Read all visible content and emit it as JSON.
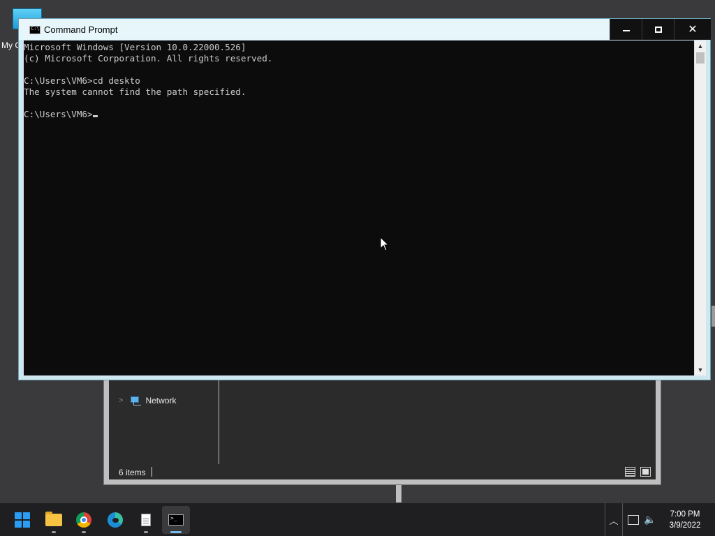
{
  "desktop": {
    "icon_label": "My C"
  },
  "explorer": {
    "nav_items": [
      {
        "label": "Network",
        "icon": "network-icon"
      }
    ],
    "status_text": "6 items"
  },
  "cmd": {
    "title": "Command Prompt",
    "lines": [
      "Microsoft Windows [Version 10.0.22000.526]",
      "(c) Microsoft Corporation. All rights reserved.",
      "",
      "C:\\Users\\VM6>cd deskto",
      "The system cannot find the path specified.",
      "",
      "C:\\Users\\VM6>"
    ],
    "controls": {
      "minimize": "minimize-icon",
      "maximize": "maximize-icon",
      "close": "close-icon"
    }
  },
  "taskbar": {
    "apps": [
      {
        "name": "start",
        "icon": "windows-start-icon"
      },
      {
        "name": "file-explorer",
        "icon": "folder-icon",
        "running": true
      },
      {
        "name": "chrome",
        "icon": "chrome-icon",
        "running": true
      },
      {
        "name": "edge",
        "icon": "edge-icon",
        "running": false
      },
      {
        "name": "notepad",
        "icon": "notepad-icon",
        "running": true
      },
      {
        "name": "command-prompt",
        "icon": "cmd-icon",
        "running": true,
        "active": true
      }
    ],
    "tray": {
      "time": "7:00 PM",
      "date": "3/9/2022"
    }
  }
}
